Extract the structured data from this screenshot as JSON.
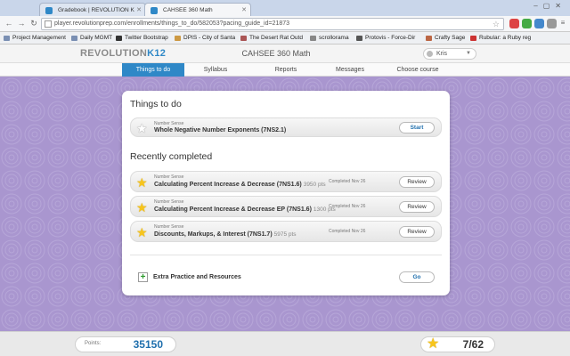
{
  "browser": {
    "tabs": [
      {
        "title": "Gradebook | REVOLUTION K",
        "active": false
      },
      {
        "title": "CAHSEE 360 Math",
        "active": true
      }
    ],
    "url": "player.revolutionprep.com/enrollments/things_to_do/582053?pacing_guide_id=21873",
    "bookmarks": [
      "Project Management",
      "Daily MGMT",
      "Twitter Bootstrap",
      "DPIS - City of Santa",
      "The Desert Rat Outd",
      "scrollorama",
      "Protovis - Force-Dir",
      "Crafty Sage",
      "Rubular: a Ruby reg"
    ]
  },
  "app": {
    "logo_text": "REVOLUTION",
    "logo_suffix": "K12",
    "course_title": "CAHSEE 360 Math",
    "user_name": "Kris",
    "nav": [
      "Things to do",
      "Syllabus",
      "Reports",
      "Messages",
      "Choose course"
    ],
    "active_nav": "Things to do",
    "accent_color": "#2f88c7",
    "background_color": "#a996cf"
  },
  "things_to_do": {
    "heading": "Things to do",
    "items": [
      {
        "category": "Number Sense",
        "title": "Whole Negative Number Exponents (7NS2.1)",
        "action": "Start",
        "star": "empty"
      }
    ]
  },
  "recently_completed": {
    "heading": "Recently completed",
    "items": [
      {
        "category": "Number Sense",
        "title": "Calculating Percent Increase & Decrease (7NS1.6)",
        "points": "3950 pts",
        "completed": "Completed Nov 26",
        "action": "Review",
        "star": "filled"
      },
      {
        "category": "Number Sense",
        "title": "Calculating Percent Increase & Decrease EP (7NS1.6)",
        "points": "1300 pts",
        "completed": "Completed Nov 26",
        "action": "Review",
        "star": "filled"
      },
      {
        "category": "Number Sense",
        "title": "Discounts, Markups, & Interest (7NS1.7)",
        "points": "5975 pts",
        "completed": "Completed Nov 26",
        "action": "Review",
        "star": "filled"
      }
    ]
  },
  "extra": {
    "label": "Extra Practice and Resources",
    "action": "Go"
  },
  "footer": {
    "points_label": "Points:",
    "points_value": "35150",
    "stars_value": "7/62"
  }
}
